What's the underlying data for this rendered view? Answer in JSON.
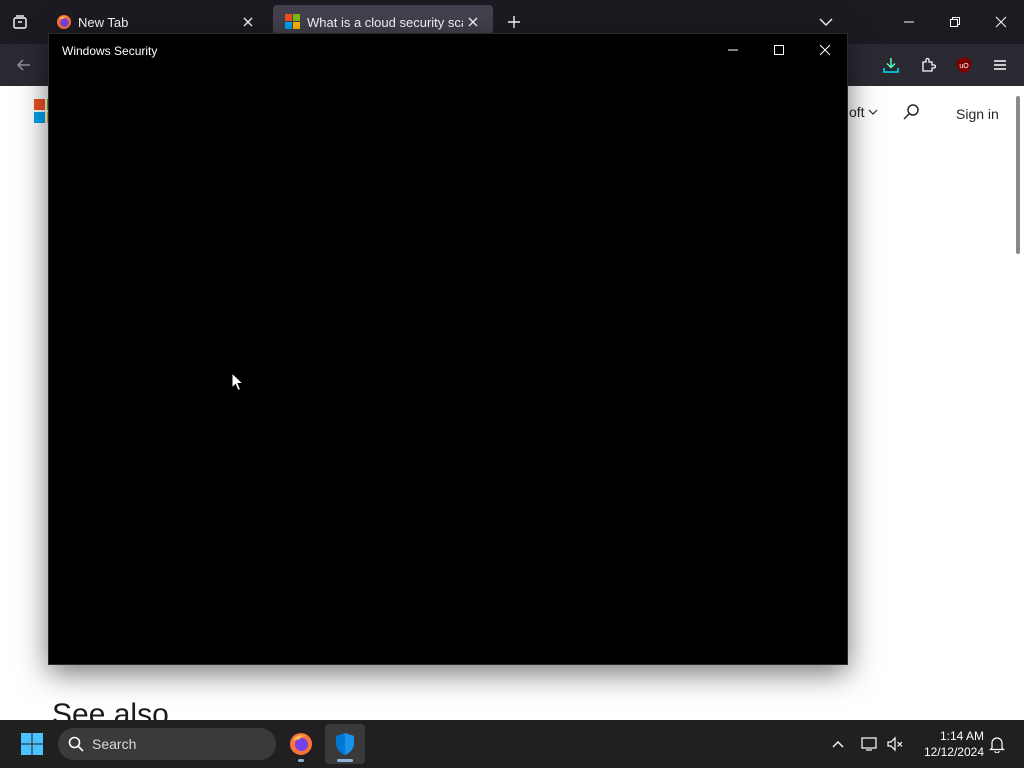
{
  "browser": {
    "tabs": [
      {
        "title": "New Tab",
        "favicon": "firefox-icon",
        "active": false
      },
      {
        "title": "What is a cloud security scan? ·",
        "favicon": "microsoft-icon",
        "active": true
      }
    ],
    "toolbar_icons": [
      "download-icon",
      "extensions-icon",
      "ublock-icon",
      "menu-icon"
    ],
    "ublock_badge": "uO"
  },
  "page": {
    "nav_text": "oft",
    "sign_in": "Sign in",
    "see_also": "See also"
  },
  "security_window": {
    "title": "Windows Security"
  },
  "taskbar": {
    "search_label": "Search",
    "time": "1:14 AM",
    "date": "12/12/2024",
    "pinned_apps": [
      "firefox-icon",
      "windows-security-icon"
    ]
  },
  "colors": {
    "tabbar_bg": "#1c1b22",
    "navbar_bg": "#2b2a33",
    "active_tab_bg": "#42414d",
    "window_bg": "#000000",
    "taskbar_bg": "#202020",
    "accent_blue": "#0078d4"
  }
}
